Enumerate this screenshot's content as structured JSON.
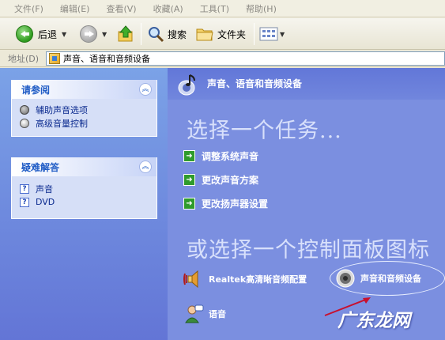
{
  "menubar": {
    "items": [
      "文件(F)",
      "编辑(E)",
      "查看(V)",
      "收藏(A)",
      "工具(T)",
      "帮助(H)"
    ]
  },
  "toolbar": {
    "back_label": "后退",
    "search_label": "搜索",
    "folders_label": "文件夹"
  },
  "address": {
    "label": "地址(D)",
    "value": "声音、语音和音频设备"
  },
  "sidebar": {
    "see_also": {
      "title": "请参阅",
      "links": [
        "辅助声音选项",
        "高级音量控制"
      ]
    },
    "troubleshoot": {
      "title": "疑难解答",
      "links": [
        "声音",
        "DVD"
      ]
    }
  },
  "main": {
    "category_title": "声音、语音和音频设备",
    "task_heading": "选择一个任务...",
    "tasks": [
      "调整系统声音",
      "更改声音方案",
      "更改扬声器设置"
    ],
    "cp_heading": "或选择一个控制面板图标",
    "icons": {
      "realtek": "Realtek高清晰音频配置",
      "sound_devices": "声音和音频设备",
      "speech": "语音"
    }
  },
  "watermark": "广东龙网",
  "colors": {
    "left_pane": "#6f8ce0",
    "right_pane": "#7b8fe0",
    "link": "#0b2a8f",
    "annotation_arrow": "#c8102e"
  }
}
